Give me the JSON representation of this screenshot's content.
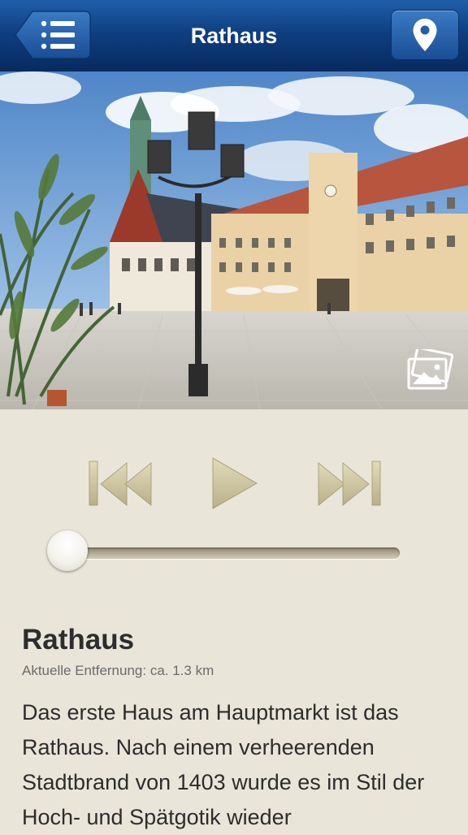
{
  "navbar": {
    "title": "Rathaus",
    "back_icon": "list-icon",
    "location_icon": "map-pin-icon"
  },
  "photo": {
    "description_icon": "gallery-icon"
  },
  "player": {
    "rewind_icon": "skip-back-icon",
    "play_icon": "play-icon",
    "forward_icon": "skip-forward-icon",
    "progress": 0
  },
  "content": {
    "title": "Rathaus",
    "distance": "Aktuelle Entfernung: ca. 1.3 km",
    "body": "Das erste Haus am Hauptmarkt ist das Rathaus. Nach einem verheerenden Stadtbrand von 1403 wurde es im Stil der Hoch- und Spätgotik wieder"
  },
  "colors": {
    "navbar": "#0f3f82",
    "background": "#e9e5d9",
    "controls": "#d6cfa8"
  }
}
